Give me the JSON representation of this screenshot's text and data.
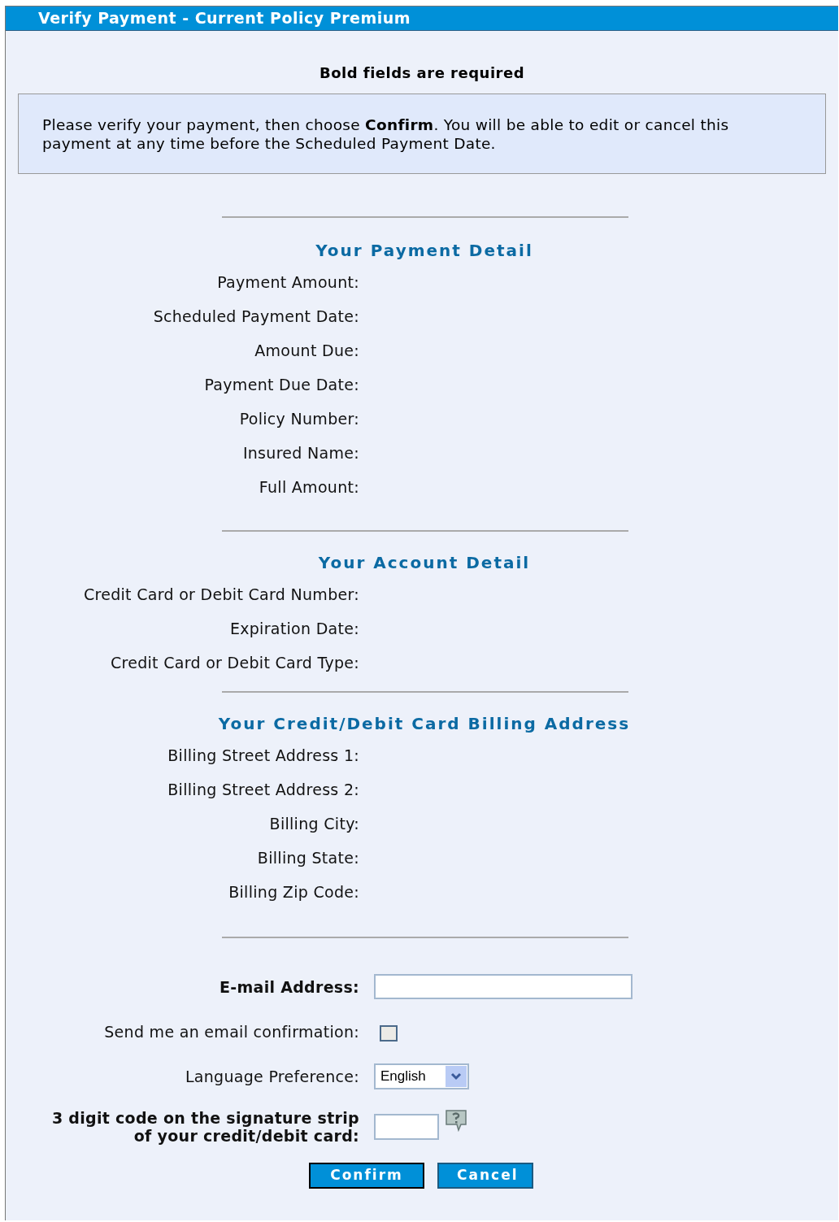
{
  "window": {
    "title": "Verify Payment - Current Policy Premium"
  },
  "required_note": "Bold fields are required",
  "info": "Please verify your payment, then choose **Confirm**. You will be able to edit or cancel this payment at any time before the Scheduled Payment Date.",
  "sections": [
    {
      "heading": "Your Payment Detail",
      "fields": [
        "Payment Amount:",
        "Scheduled Payment Date:",
        "Amount Due:",
        "Payment Due Date:",
        "Policy Number:",
        "Insured Name:",
        "Full Amount:"
      ]
    },
    {
      "heading": "Your Account Detail",
      "fields": [
        "Credit Card or Debit Card Number:",
        "Expiration Date:",
        "Credit Card or Debit Card Type:"
      ]
    },
    {
      "heading": "Your Credit/Debit Card Billing Address",
      "fields": [
        "Billing Street Address 1:",
        "Billing Street Address 2:",
        "Billing City:",
        "Billing State:",
        "Billing Zip Code:"
      ]
    }
  ],
  "form": [
    {
      "kind": "text",
      "label": "E-mail Address:",
      "required": true
    },
    {
      "kind": "checkbox",
      "label": "Send me an email confirmation:",
      "required": false,
      "checked": false
    },
    {
      "kind": "select",
      "label": "Language Preference:",
      "required": false,
      "value": "English"
    },
    {
      "kind": "code",
      "label_lines": [
        "3 digit code on the signature strip",
        "of your credit/debit card:"
      ],
      "required": true
    }
  ],
  "buttons": [
    {
      "label": "Confirm",
      "focused": true
    },
    {
      "label": "Cancel",
      "focused": false
    }
  ]
}
